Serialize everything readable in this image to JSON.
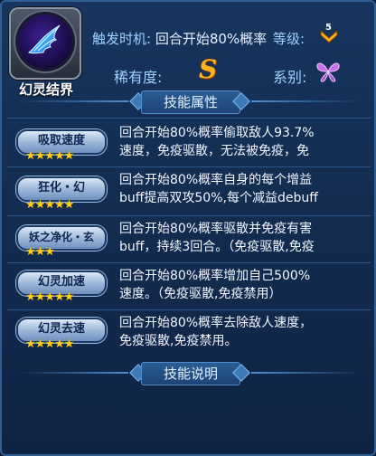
{
  "skill": {
    "name": "幻灵结界",
    "icon": "blue-wing-icon"
  },
  "header": {
    "trigger_label": "触发时机:",
    "trigger_value": "回合开始80%概率",
    "level_label": "等级:",
    "level_value": "5",
    "rarity_label": "稀有度:",
    "rarity_value": "S",
    "series_label": "系别:",
    "series_icon": "butterfly-icon"
  },
  "sections": {
    "attributes_title": "技能属性",
    "description_title": "技能说明"
  },
  "attributes": [
    {
      "name": "吸取速度",
      "stars": "★★★★★",
      "lines": [
        "回合开始80%概率偷取敌人93.7%",
        "速度，免疫驱散，无法被免疫，免"
      ]
    },
    {
      "name": "狂化・幻",
      "stars": "★★★★★",
      "lines": [
        "回合开始80%概率自身的每个增益",
        "buff提高双攻50%,每个减益debuff"
      ]
    },
    {
      "name": "妖之净化・玄",
      "stars": "★★★",
      "lines": [
        "回合开始80%概率驱散并免疫有害",
        "buff，持续3回合。（免疫驱散,免疫"
      ]
    },
    {
      "name": "幻灵加速",
      "stars": "★★★★★",
      "lines": [
        "回合开始80%概率增加自己500%",
        "速度。（免疫驱散,免疫禁用）"
      ]
    },
    {
      "name": "幻灵去速",
      "stars": "★★★★★",
      "lines": [
        "回合开始80%概率去除敌人速度，",
        "免疫驱散,免疫禁用。"
      ]
    }
  ],
  "colors": {
    "label_blue": "#9fd2ff",
    "rarity_gold": "#ffb41e",
    "star_gold": "#ffd21a"
  }
}
